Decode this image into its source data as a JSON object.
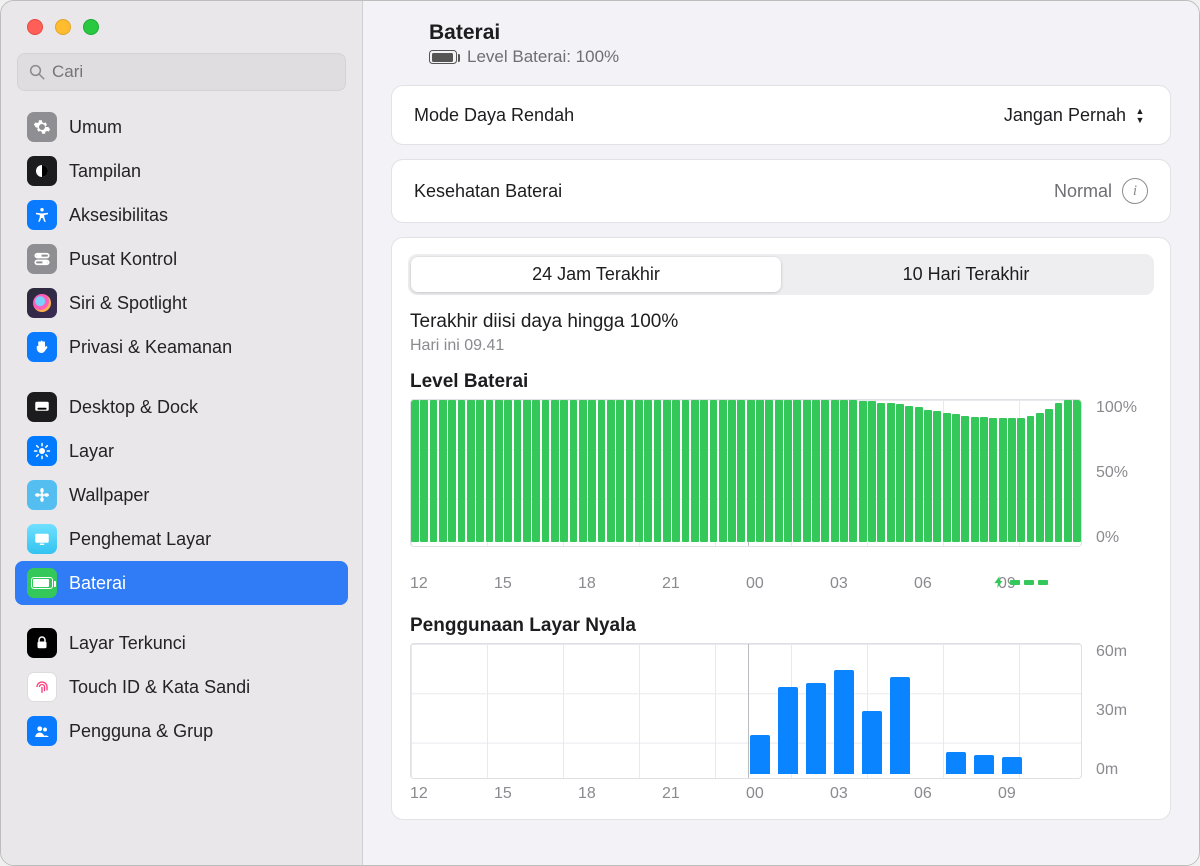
{
  "search": {
    "placeholder": "Cari"
  },
  "sidebar": {
    "groups": [
      [
        {
          "id": "umum",
          "label": "Umum"
        },
        {
          "id": "tampilan",
          "label": "Tampilan"
        },
        {
          "id": "aksesibilitas",
          "label": "Aksesibilitas"
        },
        {
          "id": "pusat-kontrol",
          "label": "Pusat Kontrol"
        },
        {
          "id": "siri",
          "label": "Siri & Spotlight"
        },
        {
          "id": "privasi",
          "label": "Privasi & Keamanan"
        }
      ],
      [
        {
          "id": "desktop-dock",
          "label": "Desktop & Dock"
        },
        {
          "id": "layar",
          "label": "Layar"
        },
        {
          "id": "wallpaper",
          "label": "Wallpaper"
        },
        {
          "id": "penghemat",
          "label": "Penghemat Layar"
        },
        {
          "id": "baterai",
          "label": "Baterai",
          "selected": true
        }
      ],
      [
        {
          "id": "layar-terkunci",
          "label": "Layar Terkunci"
        },
        {
          "id": "touchid",
          "label": "Touch ID & Kata Sandi"
        },
        {
          "id": "pengguna",
          "label": "Pengguna & Grup"
        }
      ]
    ]
  },
  "header": {
    "title": "Baterai",
    "level_label": "Level Baterai: 100%"
  },
  "low_power": {
    "label": "Mode Daya Rendah",
    "value": "Jangan Pernah"
  },
  "health": {
    "label": "Kesehatan Baterai",
    "value": "Normal"
  },
  "segmented": {
    "last24": "24 Jam Terakhir",
    "last10d": "10 Hari Terakhir",
    "active": "last24"
  },
  "last_charged": {
    "title": "Terakhir diisi daya hingga 100%",
    "time": "Hari ini 09.41"
  },
  "chart_data": [
    {
      "id": "battery_level",
      "type": "bar",
      "title": "Level Baterai",
      "x_ticks": [
        "12",
        "15",
        "18",
        "21",
        "00",
        "03",
        "06",
        "09"
      ],
      "y_ticks": [
        "100%",
        "50%",
        "0%"
      ],
      "ylim": [
        0,
        100
      ],
      "values": [
        100,
        100,
        100,
        100,
        100,
        100,
        100,
        100,
        100,
        100,
        100,
        100,
        100,
        100,
        100,
        100,
        100,
        100,
        100,
        100,
        100,
        100,
        100,
        100,
        100,
        100,
        100,
        100,
        100,
        100,
        100,
        100,
        100,
        100,
        100,
        100,
        100,
        100,
        100,
        100,
        100,
        100,
        100,
        100,
        100,
        100,
        100,
        100,
        99,
        99,
        98,
        98,
        97,
        96,
        95,
        93,
        92,
        91,
        90,
        89,
        88,
        88,
        87,
        87,
        87,
        87,
        89,
        91,
        94,
        98,
        100,
        100
      ],
      "charging_marker_at": 66
    },
    {
      "id": "screen_on_usage",
      "type": "bar",
      "title": "Penggunaan Layar Nyala",
      "x_ticks": [
        "12",
        "15",
        "18",
        "21",
        "00",
        "03",
        "06",
        "09"
      ],
      "y_ticks": [
        "60m",
        "30m",
        "0m"
      ],
      "ylim": [
        0,
        60
      ],
      "values": [
        0,
        0,
        0,
        0,
        0,
        0,
        0,
        0,
        0,
        0,
        0,
        0,
        18,
        40,
        42,
        48,
        29,
        45,
        0,
        10,
        9,
        8,
        0,
        0
      ]
    }
  ]
}
